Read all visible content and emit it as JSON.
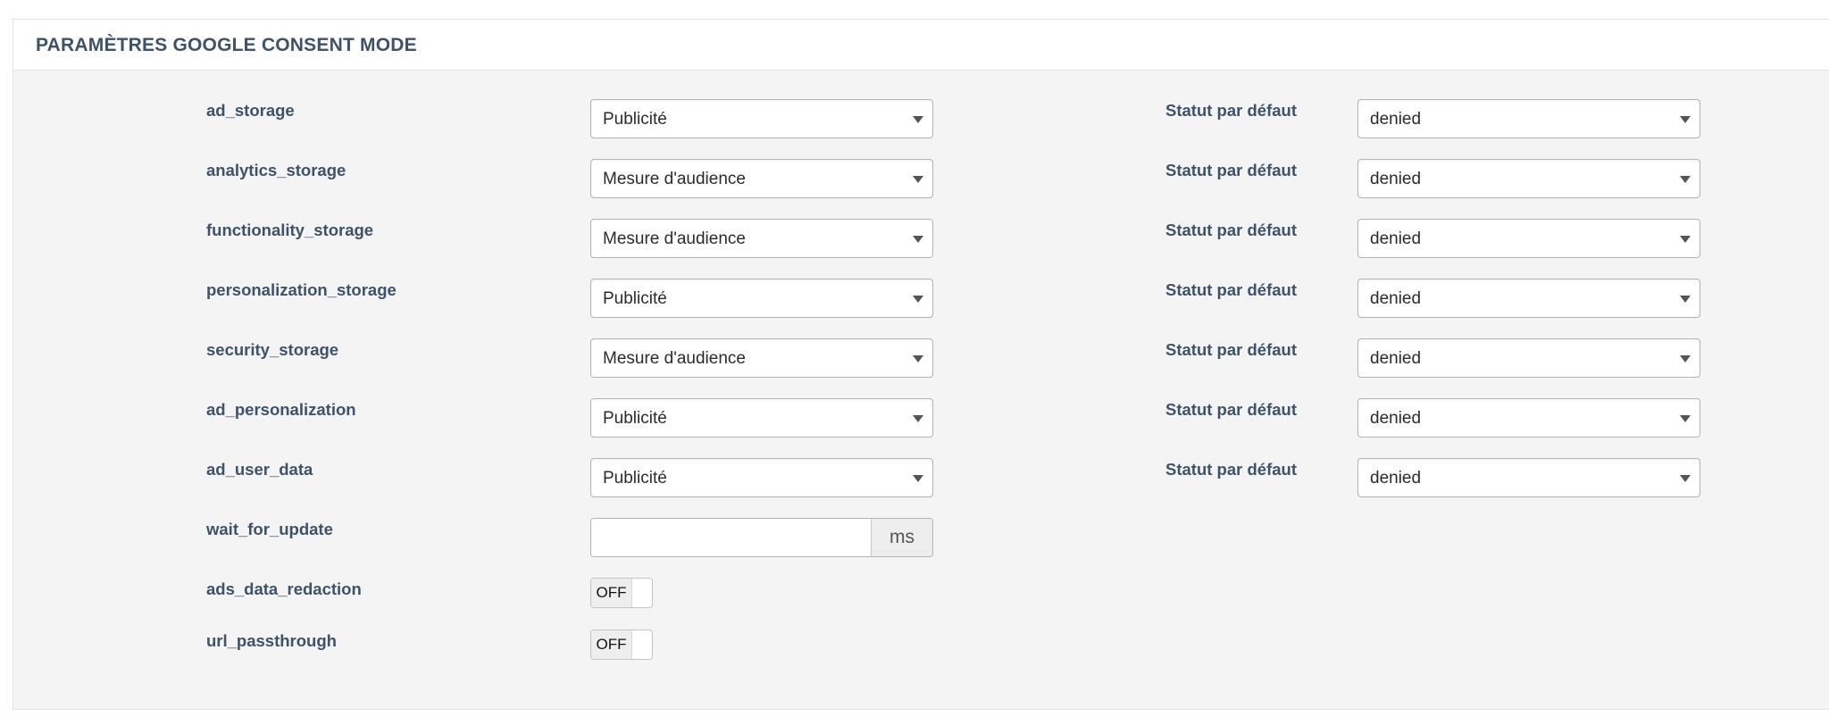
{
  "panel": {
    "title": "PARAMÈTRES GOOGLE CONSENT MODE"
  },
  "status_label": "Statut par défaut",
  "rows": [
    {
      "name": "ad_storage",
      "category": "Publicité",
      "status": "denied"
    },
    {
      "name": "analytics_storage",
      "category": "Mesure d'audience",
      "status": "denied"
    },
    {
      "name": "functionality_storage",
      "category": "Mesure d'audience",
      "status": "denied"
    },
    {
      "name": "personalization_storage",
      "category": "Publicité",
      "status": "denied"
    },
    {
      "name": "security_storage",
      "category": "Mesure d'audience",
      "status": "denied"
    },
    {
      "name": "ad_personalization",
      "category": "Publicité",
      "status": "denied"
    },
    {
      "name": "ad_user_data",
      "category": "Publicité",
      "status": "denied"
    }
  ],
  "wait_for_update": {
    "label": "wait_for_update",
    "value": "",
    "unit": "ms"
  },
  "toggles": [
    {
      "label": "ads_data_redaction",
      "state": "OFF"
    },
    {
      "label": "url_passthrough",
      "state": "OFF"
    }
  ]
}
